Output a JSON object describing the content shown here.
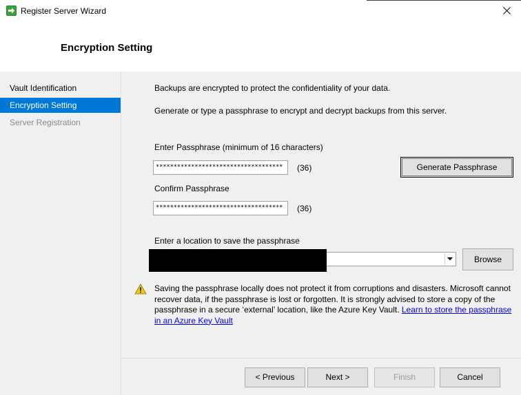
{
  "window": {
    "title": "Register Server Wizard",
    "app_icon": "wizard-arrow-icon",
    "close_icon": "close-icon"
  },
  "header": {
    "title": "Encryption Setting"
  },
  "sidebar": {
    "items": [
      {
        "label": "Vault Identification",
        "state": "normal"
      },
      {
        "label": "Encryption Setting",
        "state": "active"
      },
      {
        "label": "Server Registration",
        "state": "disabled"
      }
    ]
  },
  "main": {
    "intro1": "Backups are encrypted to protect the confidentiality of your data.",
    "intro2": "Generate or type a passphrase to encrypt and decrypt backups from this server.",
    "passphrase_label": "Enter Passphrase (minimum of 16 characters)",
    "passphrase_value": "************************************",
    "passphrase_count": "(36)",
    "generate_button": "Generate Passphrase",
    "confirm_label": "Confirm Passphrase",
    "confirm_value": "************************************",
    "confirm_count": "(36)",
    "location_label": "Enter a location to save the passphrase",
    "browse_button": "Browse",
    "warning_icon": "warning-icon",
    "warning_text": "Saving the passphrase locally does not protect it from corruptions and disasters. Microsoft cannot recover data, if the passphrase is lost or forgotten. It is strongly advised to store a copy of the passphrase in a secure ‘external’ location, like the Azure Key Vault.",
    "warning_link": "Learn to store the passphrase in an Azure Key Vault"
  },
  "footer": {
    "previous": "< Previous",
    "next": "Next >",
    "finish": "Finish",
    "cancel": "Cancel"
  },
  "colors": {
    "accent": "#0078d7",
    "panel_bg": "#f0f0f0",
    "link": "#0000ee",
    "warning": "#f2c811"
  }
}
